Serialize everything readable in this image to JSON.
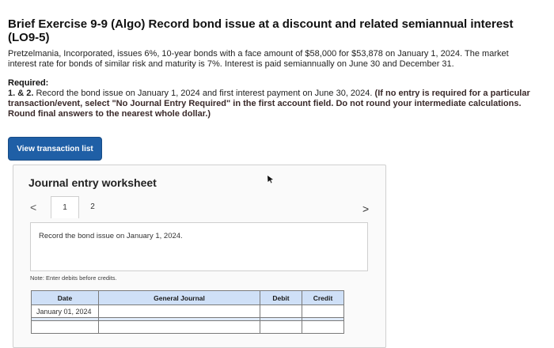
{
  "header": {
    "title": "Brief Exercise 9-9 (Algo) Record bond issue at a discount and related semiannual interest (LO9-5)"
  },
  "problem": {
    "text_line1": "Pretzelmania, Incorporated, issues 6%, 10-year bonds with a face amount of $58,000 for $53,878 on January 1, 2024. The market",
    "text_line2": "interest rate for bonds of similar risk and maturity is 7%. Interest is paid semiannually on June 30 and December 31."
  },
  "required": {
    "heading": "Required:",
    "number": "1. & 2.",
    "instruction": " Record the bond issue on January 1, 2024 and first interest payment on June 30, 2024. ",
    "emphasis": "(If no entry is required for a particular transaction/event, select \"No Journal Entry Required\" in the first account field. Do not round your intermediate calculations. Round final answers to the nearest whole dollar.)"
  },
  "toolbar": {
    "view_transaction_list": "View transaction list"
  },
  "worksheet": {
    "title": "Journal entry worksheet",
    "prev_glyph": "<",
    "next_glyph": ">",
    "tabs": [
      "1",
      "2"
    ],
    "task_text": "Record the bond issue on January 1, 2024.",
    "note": "Note: Enter debits before credits."
  },
  "journal_table": {
    "headers": {
      "date": "Date",
      "account": "General Journal",
      "debit": "Debit",
      "credit": "Credit"
    },
    "rows": [
      {
        "date": "January 01, 2024"
      }
    ]
  },
  "colors": {
    "button_bg": "#1f5fa6",
    "table_header_bg": "#cfe0f7"
  }
}
